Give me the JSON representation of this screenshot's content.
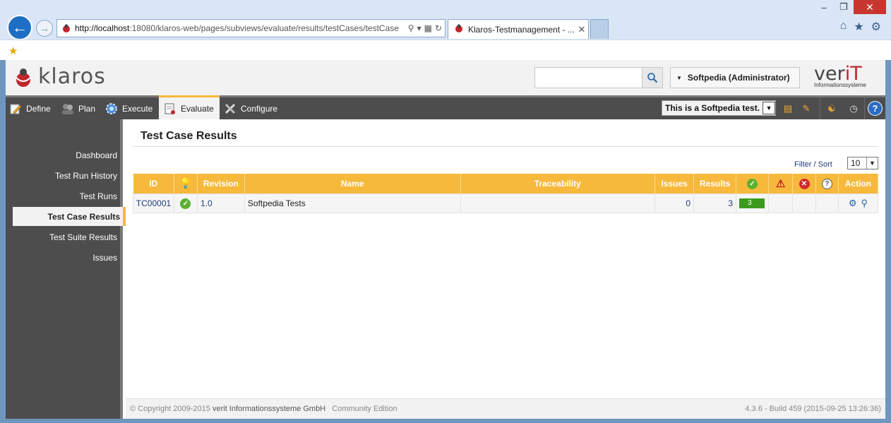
{
  "browser": {
    "url_host": "http://localhost",
    "url_rest": ":18080/klaros-web/pages/subviews/evaluate/results/testCases/testCase",
    "tab_title": "Klaros-Testmanagement - ...",
    "minimize": "–",
    "restore": "❐",
    "close": "✕",
    "home_icon": "home-icon",
    "star_icon": "favorites-icon",
    "gear_icon": "gear-icon"
  },
  "header": {
    "logo_text": "klaros",
    "search_placeholder": "",
    "user_label": "Softpedia (Administrator)",
    "company_main": "ver",
    "company_accent": "iT",
    "company_sub": "Informationssysteme"
  },
  "menu": {
    "items": [
      {
        "label": "Define",
        "icon": "pencil-icon"
      },
      {
        "label": "Plan",
        "icon": "people-icon"
      },
      {
        "label": "Execute",
        "icon": "gear-icon"
      },
      {
        "label": "Evaluate",
        "icon": "report-icon"
      },
      {
        "label": "Configure",
        "icon": "tools-icon"
      }
    ],
    "active": "Evaluate",
    "project": "This is a Softpedia test."
  },
  "sidebar": {
    "items": [
      {
        "label": "Dashboard"
      },
      {
        "label": "Test Run History"
      },
      {
        "label": "Test Runs"
      },
      {
        "label": "Test Case Results"
      },
      {
        "label": "Test Suite Results"
      },
      {
        "label": "Issues"
      }
    ],
    "active": "Test Case Results"
  },
  "main": {
    "title": "Test Case Results",
    "filter_label": "Filter / Sort",
    "page_size": "10",
    "columns": [
      "ID",
      "",
      "Revision",
      "Name",
      "Traceability",
      "Issues",
      "Results",
      "",
      "",
      "",
      "",
      "Action"
    ],
    "rows": [
      {
        "id": "TC00001",
        "revision": "1.0",
        "name": "Softpedia Tests",
        "traceability": "",
        "issues": "0",
        "results": "3",
        "passed": "3"
      }
    ]
  },
  "footer": {
    "copyright": "© Copyright 2009-2015",
    "company": "verit Informationssysteme GmbH",
    "edition": "Community Edition",
    "version": "4.3.6 - Build 459 (2015-09-25 13:26:36)"
  },
  "colors": {
    "accent": "#f7b93b",
    "menu_bg": "#4d4d4d",
    "pass": "#3c9a1f",
    "error": "#d2282e",
    "link": "#1f3d7a"
  }
}
